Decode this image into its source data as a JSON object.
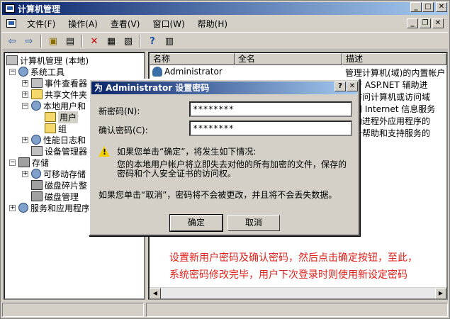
{
  "window": {
    "title": "计算机管理",
    "minimize": "_",
    "maximize": "□",
    "close": "✕"
  },
  "menu": {
    "items": [
      "文件(F)",
      "操作(A)",
      "查看(V)",
      "窗口(W)",
      "帮助(H)"
    ]
  },
  "mdi": {
    "minimize": "_",
    "restore": "❐",
    "close": "✕"
  },
  "toolbar": {
    "back": "⇦",
    "forward": "⇨",
    "up": "▣",
    "show": "▤",
    "delete": "✕",
    "props": "▦",
    "export": "▧",
    "help": "?",
    "view": "▥"
  },
  "tree": {
    "root": "计算机管理 (本地)",
    "system_tools": "系统工具",
    "event_viewer": "事件查看器",
    "shared_folders": "共享文件夹",
    "local_users": "本地用户和",
    "users": "用户",
    "groups": "组",
    "perf_logs": "性能日志和",
    "device_manager": "设备管理器",
    "storage": "存储",
    "removable": "可移动存储",
    "defrag": "磁盘碎片整",
    "disk_mgmt": "磁盘管理",
    "services": "服务和应用程序"
  },
  "list": {
    "columns": [
      "名称",
      "全名",
      "描述"
    ],
    "rows": [
      {
        "name": "Administrator",
        "desc": "管理计算机(域)的内置帐户"
      },
      {
        "name": "",
        "desc": "运行 ASP.NET 辅助进"
      },
      {
        "name": "",
        "desc": "宾访问计算机或访问域"
      },
      {
        "name": "",
        "desc": "访问 Internet 信息服务"
      },
      {
        "name": "",
        "desc": "启动进程外应用程序的"
      },
      {
        "name": "",
        "desc": "一个帮助和支持服务的"
      }
    ]
  },
  "annotation": {
    "line1": "设置新用户密码及确认密码，然后点击确定按钮，至此，",
    "line2": "系统密码修改完毕，用户下次登录时则使用新设定密码"
  },
  "dialog": {
    "title": "为 Administrator 设置密码",
    "help_btn": "?",
    "close_btn": "✕",
    "new_pw_label": "新密码(N):",
    "new_pw_value": "********",
    "confirm_pw_label": "确认密码(C):",
    "confirm_pw_value": "********",
    "warn_line1": "如果您单击“确定”，将发生如下情况:",
    "warn_line2": "您的本地用户帐户将立即失去对他的所有加密的文件，保存的",
    "warn_line3": "密码和个人安全证书的访问权。",
    "cancel_note": "如果您单击“取消”，密码将不会被更改，并且将不会丢失数据。",
    "ok": "确定",
    "cancel": "取消"
  }
}
